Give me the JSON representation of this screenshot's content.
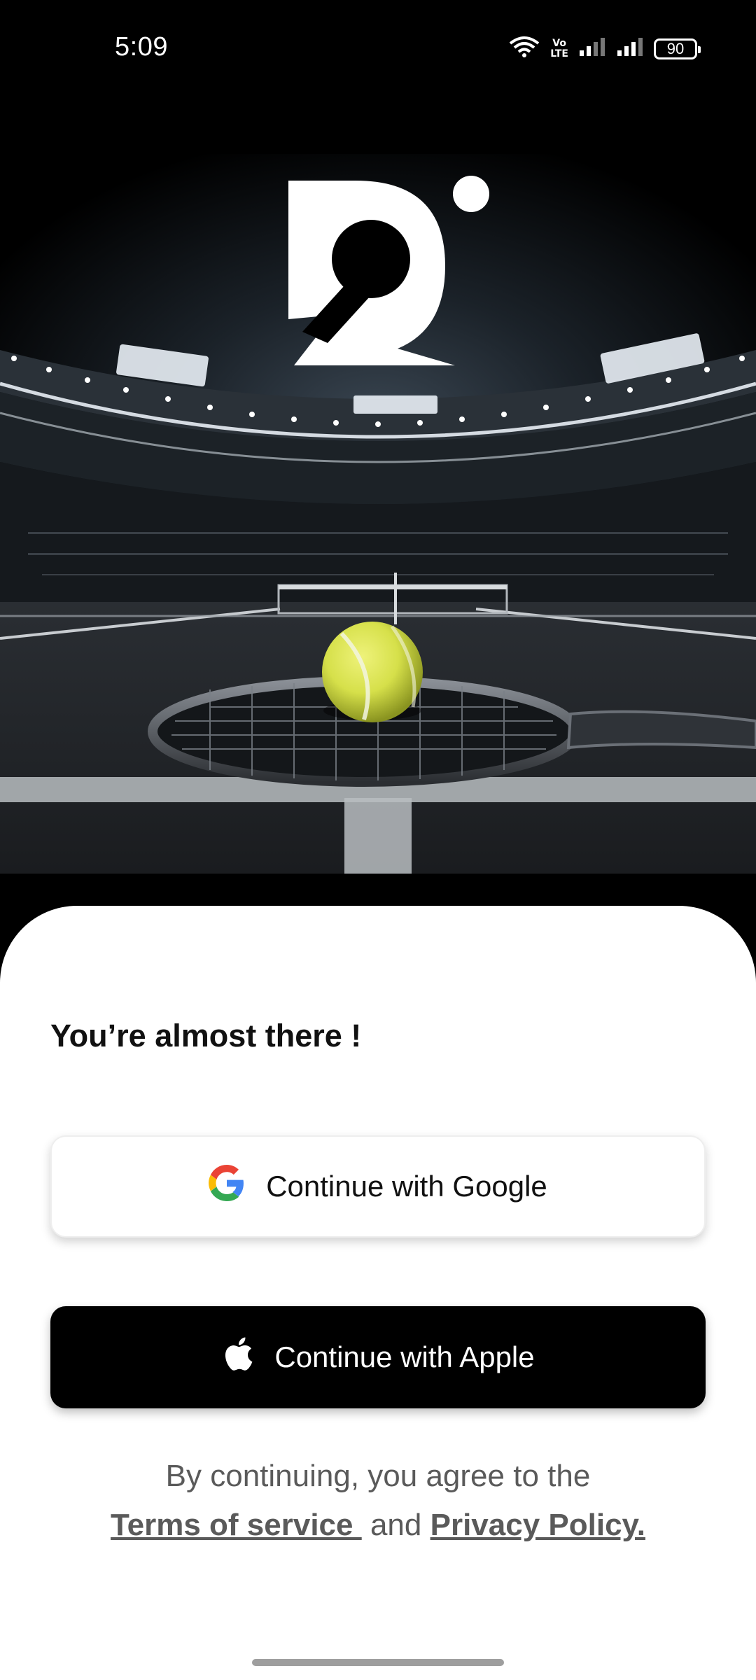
{
  "status_bar": {
    "time": "5:09",
    "volte_top": "Vo",
    "volte_bottom": "LTE",
    "battery": "90"
  },
  "hero": {
    "logo_letter": "R",
    "icons": [
      "tennis-stadium-image",
      "app-logo-icon",
      "tennis-ball-icon",
      "tennis-racket-icon"
    ]
  },
  "sheet": {
    "title": "You’re almost there !",
    "google_button_label": "Continue with Google",
    "apple_button_label": "Continue with Apple",
    "legal_prefix": "By continuing, you agree to the",
    "terms_label": "Terms of service ",
    "and_label": " and ",
    "privacy_label": "Privacy Policy."
  },
  "colors": {
    "sheet_background": "#ffffff",
    "apple_button": "#000000",
    "google_blue": "#4285F4",
    "google_red": "#EA4335",
    "google_yellow": "#FBBC05",
    "google_green": "#34A853",
    "ball": "#d6e04a",
    "legal_text": "#5a5a5a"
  }
}
